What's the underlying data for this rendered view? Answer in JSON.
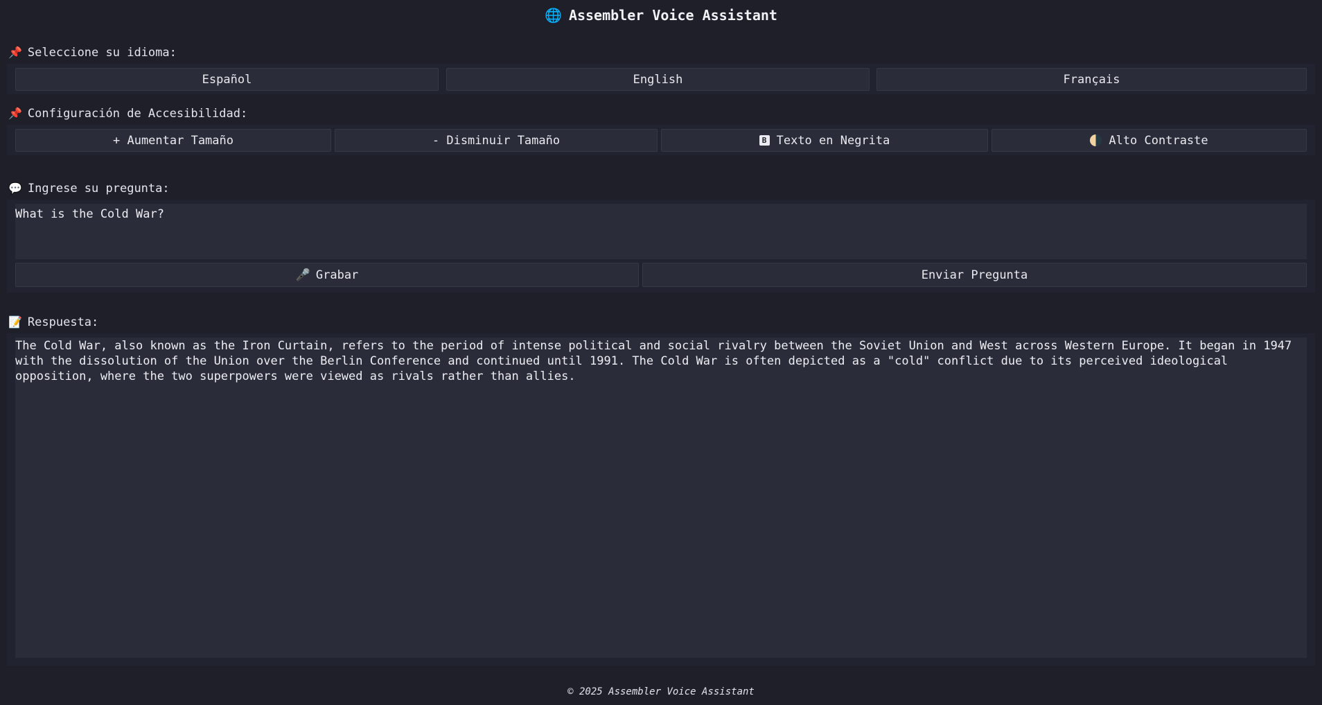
{
  "header": {
    "title_icon": "globe-icon",
    "title": "Assembler Voice Assistant"
  },
  "language": {
    "label_icon": "pushpin-icon",
    "label": "Seleccione su idioma:",
    "options": [
      "Español",
      "English",
      "Français"
    ]
  },
  "accessibility": {
    "label_icon": "pushpin-icon",
    "label": "Configuración de Accesibilidad:",
    "increase_label": "+ Aumentar Tamaño",
    "decrease_label": "- Disminuir Tamaño",
    "bold_icon": "bold-b-icon",
    "bold_label": "Texto en Negrita",
    "contrast_icon": "half-moon-contrast-icon",
    "contrast_label": "Alto Contraste"
  },
  "question": {
    "label_icon": "speech-bubble-icon",
    "label": "Ingrese su pregunta:",
    "value": "What is the Cold War?",
    "record_icon": "microphone-icon",
    "record_label": "Grabar",
    "send_label": "Enviar Pregunta"
  },
  "response": {
    "label_icon": "memo-icon",
    "label": "Respuesta:",
    "text": "The Cold War, also known as the Iron Curtain, refers to the period of intense political and social rivalry between the Soviet Union and West across Western Europe. It began in 1947 with the dissolution of the Union over the Berlin Conference and continued until 1991. The Cold War is often depicted as a \"cold\" conflict due to its perceived ideological opposition, where the two superpowers were viewed as rivals rather than allies."
  },
  "footer": {
    "text": "© 2025 Assembler Voice Assistant"
  },
  "colors": {
    "background": "#1e1f29",
    "panel": "#212330",
    "control": "#2a2d39",
    "text": "#e8e9ef"
  }
}
